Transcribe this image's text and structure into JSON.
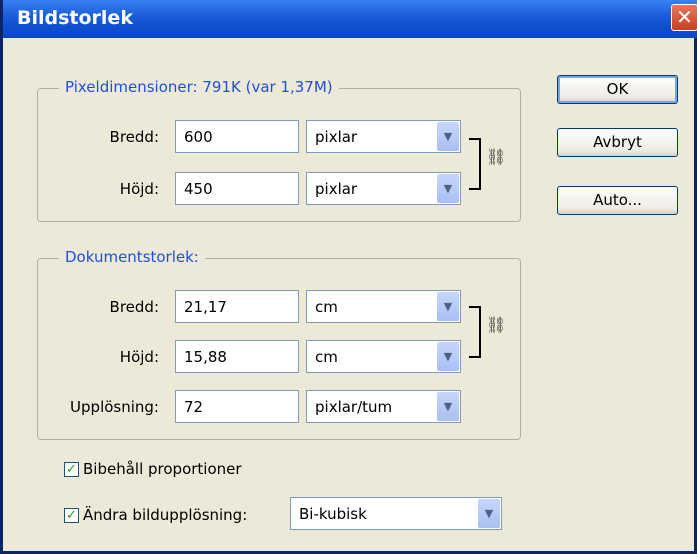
{
  "window": {
    "title": "Bildstorlek",
    "close": "✕"
  },
  "pixel_group": {
    "legend": "Pixeldimensioner: 791K (var 1,37M)",
    "width_label": "Bredd:",
    "width_value": "600",
    "width_unit": "pixlar",
    "height_label": "Höjd:",
    "height_value": "450",
    "height_unit": "pixlar"
  },
  "doc_group": {
    "legend": "Dokumentstorlek:",
    "width_label": "Bredd:",
    "width_value": "21,17",
    "width_unit": "cm",
    "height_label": "Höjd:",
    "height_value": "15,88",
    "height_unit": "cm",
    "resolution_label": "Upplösning:",
    "resolution_value": "72",
    "resolution_unit": "pixlar/tum"
  },
  "buttons": {
    "ok": "OK",
    "cancel": "Avbryt",
    "auto": "Auto..."
  },
  "options": {
    "constrain_label": "Bibehåll proportioner",
    "constrain_checked": true,
    "resample_label": "Ändra bildupplösning:",
    "resample_checked": true,
    "resample_method": "Bi-kubisk"
  },
  "icons": {
    "dropdown": "chevron-down-icon",
    "link": "chain-link-icon",
    "check": "checkmark-icon"
  },
  "colors": {
    "titlebar": "#0A47C4",
    "legend": "#1F50D8",
    "dialog_bg": "#ECE9D8"
  }
}
